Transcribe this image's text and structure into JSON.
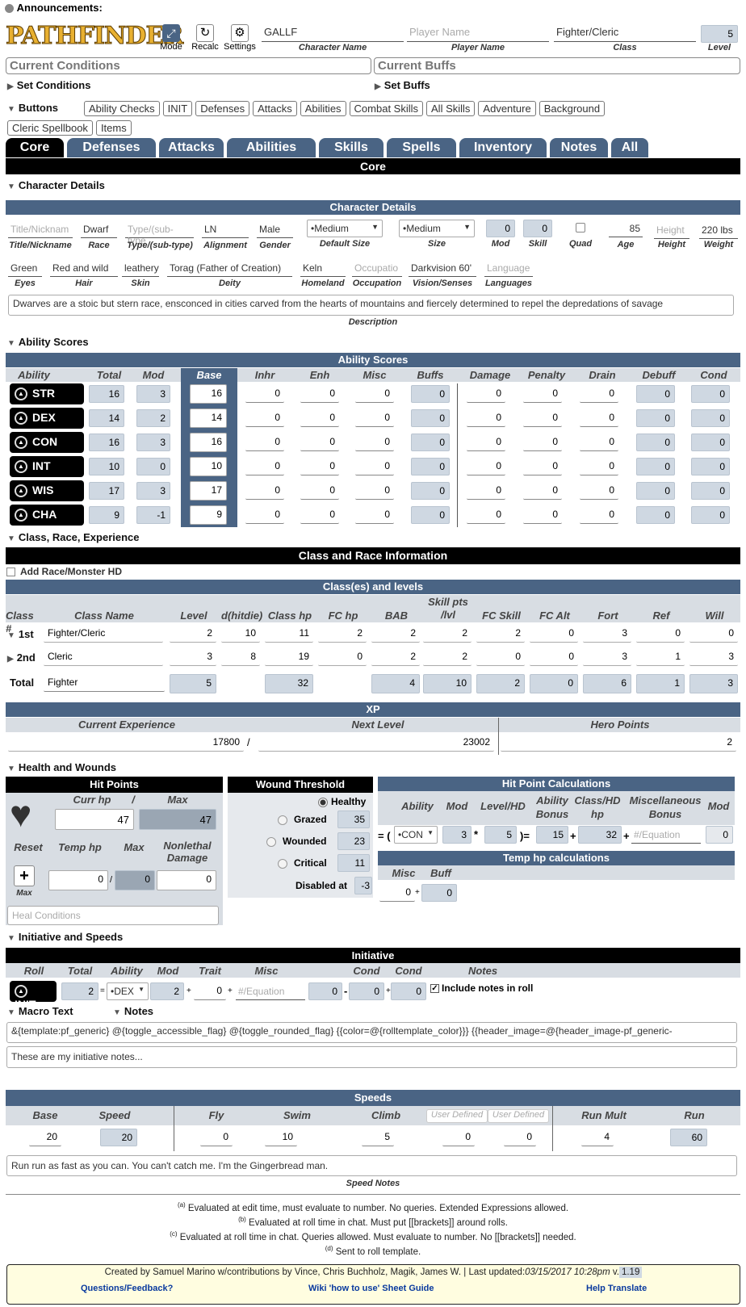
{
  "announce": "Announcements:",
  "logo": "PATHFINDER",
  "toolbar": {
    "mode": "Mode",
    "recalc": "Recalc",
    "settings": "Settings"
  },
  "header": {
    "char_name": "GALLF",
    "char_name_lbl": "Character Name",
    "player_ph": "Player Name",
    "player_lbl": "Player Name",
    "class": "Fighter/Cleric",
    "class_lbl": "Class",
    "level": "5",
    "level_lbl": "Level"
  },
  "conditions": {
    "title": "Current Conditions",
    "set": "Set Conditions"
  },
  "buffs": {
    "title": "Current Buffs",
    "set": "Set Buffs"
  },
  "buttons": {
    "label": "Buttons",
    "items": [
      "Ability Checks",
      "INIT",
      "Defenses",
      "Attacks",
      "Abilities",
      "Combat Skills",
      "All Skills",
      "Adventure",
      "Background",
      "Cleric Spellbook",
      "Items"
    ]
  },
  "tabs": [
    "Core",
    "Defenses",
    "Attacks",
    "Abilities",
    "Skills",
    "Spells",
    "Inventory",
    "Notes",
    "All"
  ],
  "core_bar": "Core",
  "details": {
    "section": "Character Details",
    "bar": "Character Details",
    "row1": [
      {
        "v": "Title/Nicknam",
        "ph": true,
        "l": "Title/Nickname"
      },
      {
        "v": "Dwarf",
        "l": "Race"
      },
      {
        "v": "Type/(sub-type",
        "ph": true,
        "l": "Type/(sub-type)"
      },
      {
        "v": "LN",
        "l": "Alignment"
      },
      {
        "v": "Male",
        "l": "Gender"
      }
    ],
    "default_size": "•Medium",
    "default_size_lbl": "Default Size",
    "size": "•Medium",
    "size_lbl": "Size",
    "mod": "0",
    "mod_lbl": "Mod",
    "skill": "0",
    "skill_lbl": "Skill",
    "quad_lbl": "Quad",
    "age": "85",
    "age_lbl": "Age",
    "height": "Height",
    "height_lbl": "Height",
    "weight": "220 lbs",
    "weight_lbl": "Weight",
    "row2": [
      {
        "v": "Green",
        "l": "Eyes"
      },
      {
        "v": "Red and wild",
        "l": "Hair"
      },
      {
        "v": "leathery",
        "l": "Skin"
      },
      {
        "v": "Torag (Father of Creation)",
        "l": "Deity"
      },
      {
        "v": "Keln",
        "l": "Homeland"
      },
      {
        "v": "Occupatio",
        "ph": true,
        "l": "Occupation"
      },
      {
        "v": "Darkvision 60'",
        "l": "Vision/Senses"
      },
      {
        "v": "Language",
        "ph": true,
        "l": "Languages"
      }
    ],
    "description": "Dwarves are a stoic but stern race, ensconced in cities carved from the hearts of mountains and fiercely determined to repel the depredations of savage",
    "description_lbl": "Description"
  },
  "abilities": {
    "section": "Ability Scores",
    "bar": "Ability Scores",
    "headers": [
      "Ability",
      "Total",
      "Mod",
      "Base",
      "Inhr",
      "Enh",
      "Misc",
      "Buffs",
      "Damage",
      "Penalty",
      "Drain",
      "Debuff",
      "Cond"
    ],
    "rows": [
      [
        "STR",
        "16",
        "3",
        "16"
      ],
      [
        "DEX",
        "14",
        "2",
        "14"
      ],
      [
        "CON",
        "16",
        "3",
        "16"
      ],
      [
        "INT",
        "10",
        "0",
        "10"
      ],
      [
        "WIS",
        "17",
        "3",
        "17"
      ],
      [
        "CHA",
        "9",
        "-1",
        "9"
      ]
    ],
    "zero": "0"
  },
  "classrace": {
    "section": "Class, Race, Experience",
    "bar": "Class and Race Information",
    "add_hd": "Add Race/Monster HD",
    "classes_bar": "Class(es) and levels",
    "headers": [
      "Class #",
      "Class Name",
      "Level",
      "d(hitdie)",
      "Class hp",
      "FC hp",
      "BAB",
      "Skill pts /lvl",
      "FC Skill",
      "FC Alt",
      "Fort",
      "Ref",
      "Will"
    ],
    "rows": [
      [
        "1st",
        "Fighter/Cleric",
        "2",
        "10",
        "11",
        "2",
        "2",
        "2",
        "2",
        "0",
        "3",
        "0",
        "0"
      ],
      [
        "2nd",
        "Cleric",
        "3",
        "8",
        "19",
        "0",
        "2",
        "2",
        "0",
        "0",
        "3",
        "1",
        "3"
      ]
    ],
    "total": [
      "Total",
      "Fighter",
      "5",
      "32",
      "4",
      "10",
      "2",
      "0",
      "6",
      "1",
      "3"
    ]
  },
  "xp": {
    "bar": "XP",
    "cur_lbl": "Current Experience",
    "next_lbl": "Next Level",
    "hero_lbl": "Hero Points",
    "cur": "17800",
    "next": "23002",
    "hero": "2"
  },
  "health": {
    "section": "Health and Wounds",
    "hp_bar": "Hit Points",
    "curr_lbl": "Curr hp",
    "max_lbl": "Max",
    "curr": "47",
    "max": "47",
    "reset": "Reset",
    "temp_lbl": "Temp hp",
    "max2_lbl": "Max",
    "nonlethal_lbl": "Nonlethal Damage",
    "temp": "0",
    "tempmax": "0",
    "nonlethal": "0",
    "max3": "Max",
    "heal_ph": "Heal Conditions",
    "wound_bar": "Wound Threshold",
    "healthy": "Healthy",
    "grazed": "Grazed",
    "grazed_v": "35",
    "wounded": "Wounded",
    "wounded_v": "23",
    "critical": "Critical",
    "critical_v": "11",
    "disabled": "Disabled at",
    "disabled_v": "-3",
    "calc_bar": "Hit Point Calculations",
    "calc_h": [
      "Ability",
      "Mod",
      "Level/HD",
      "Ability Bonus",
      "Class/HD hp",
      "Miscellaneous Bonus",
      "Mod"
    ],
    "calc_ab": "•CON",
    "calc_mod": "3",
    "calc_lvl": "5",
    "calc_bonus": "15",
    "calc_hp": "32",
    "calc_misc": "#/Equation",
    "calc_mod2": "0",
    "temp_bar": "Temp hp calculations",
    "misc_lbl": "Misc",
    "buff_lbl": "Buff",
    "misc": "0",
    "buff": "0"
  },
  "init": {
    "section": "Initiative and Speeds",
    "bar": "Initiative",
    "headers": [
      "Roll",
      "Total",
      "Ability",
      "Mod",
      "Trait",
      "Misc",
      "Cond",
      "Cond",
      "Notes"
    ],
    "roll": "INIT",
    "total": "2",
    "ability": "•DEX",
    "mod": "2",
    "trait": "0",
    "misc_ph": "#/Equation",
    "m1": "0",
    "c1": "0",
    "c2": "0",
    "include": "Include notes in roll",
    "macro": "Macro Text",
    "notes": "Notes",
    "macro_text": "&{template:pf_generic} @{toggle_accessible_flag} @{toggle_rounded_flag} {{color=@{rolltemplate_color}}} {{header_image=@{header_image-pf_generic-",
    "notes_text": "These are my initiative notes..."
  },
  "speeds": {
    "bar": "Speeds",
    "headers": [
      "Base",
      "Speed",
      "Fly",
      "Swim",
      "Climb",
      "User Defined",
      "User Defined",
      "Run Mult",
      "Run"
    ],
    "vals": [
      "20",
      "20",
      "0",
      "10",
      "5",
      "0",
      "0",
      "4",
      "60"
    ],
    "notes": "Run run as fast as you can.  You can't catch me. I'm the Gingerbread man.",
    "notes_lbl": "Speed Notes"
  },
  "footnotes": [
    "Evaluated at edit time, must evaluate to number. No queries. Extended Expressions allowed.",
    "Evaluated at roll time in chat. Must put [[brackets]] around rolls.",
    "Evaluated at roll time in chat. Queries allowed. Must evaluate to number. No [[brackets]] needed.",
    "Sent to roll template."
  ],
  "credits": {
    "text": "Created by Samuel Marino w/contributions by Vince, Chris Buchholz, Magik, James W. | Last updated:",
    "date": "03/15/2017 10:28pm",
    "v": "v.",
    "version": "1.19",
    "q": "Questions/Feedback?",
    "wiki": "Wiki 'how to use' Sheet Guide",
    "help": "Help Translate"
  }
}
